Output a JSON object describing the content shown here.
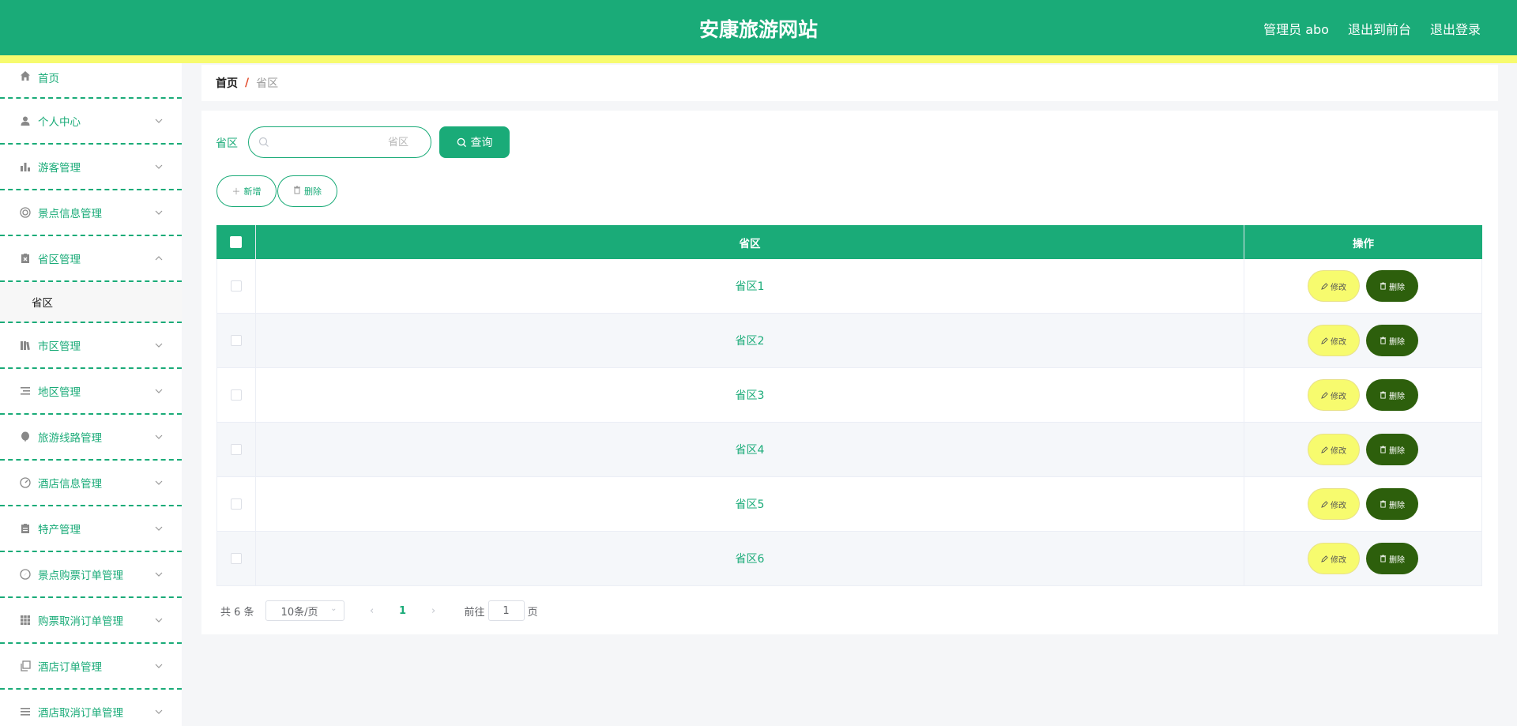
{
  "header": {
    "title": "安康旅游网站",
    "user": "管理员 abo",
    "to_front": "退出到前台",
    "logout": "退出登录"
  },
  "colors": {
    "primary": "#1aab78",
    "accent_yellow": "#f7fb6e",
    "delete_dark": "#2d5f0c"
  },
  "sidebar": {
    "home": "首页",
    "items": [
      {
        "label": "个人中心",
        "icon": "user-icon"
      },
      {
        "label": "游客管理",
        "icon": "bar-chart-icon"
      },
      {
        "label": "景点信息管理",
        "icon": "aperture-icon"
      },
      {
        "label": "省区管理",
        "icon": "clipboard-x-icon",
        "expanded": true
      },
      {
        "label": "市区管理",
        "icon": "books-icon"
      },
      {
        "label": "地区管理",
        "icon": "list-indent-icon"
      },
      {
        "label": "旅游线路管理",
        "icon": "balloon-icon"
      },
      {
        "label": "酒店信息管理",
        "icon": "gauge-icon"
      },
      {
        "label": "特产管理",
        "icon": "clipboard-icon"
      },
      {
        "label": "景点购票订单管理",
        "icon": "compass-icon"
      },
      {
        "label": "购票取消订单管理",
        "icon": "grid-icon"
      },
      {
        "label": "酒店订单管理",
        "icon": "copy-icon"
      },
      {
        "label": "酒店取消订单管理",
        "icon": "menu-icon"
      }
    ],
    "submenu_label": "省区"
  },
  "breadcrumb": {
    "home": "首页",
    "sep": "/",
    "current": "省区"
  },
  "search": {
    "label": "省区",
    "placeholder": "省区",
    "value": "",
    "button": "查询"
  },
  "actions": {
    "add": "新增",
    "delete": "删除"
  },
  "table": {
    "headers": {
      "name": "省区",
      "op": "操作"
    },
    "edit_label": "修改",
    "delete_label": "删除",
    "rows": [
      {
        "name": "省区1"
      },
      {
        "name": "省区2"
      },
      {
        "name": "省区3"
      },
      {
        "name": "省区4"
      },
      {
        "name": "省区5"
      },
      {
        "name": "省区6"
      }
    ]
  },
  "pagination": {
    "total": "共 6 条",
    "page_size": "10条/页",
    "current_page": "1",
    "goto_prefix": "前往",
    "goto_value": "1",
    "goto_suffix": "页"
  }
}
